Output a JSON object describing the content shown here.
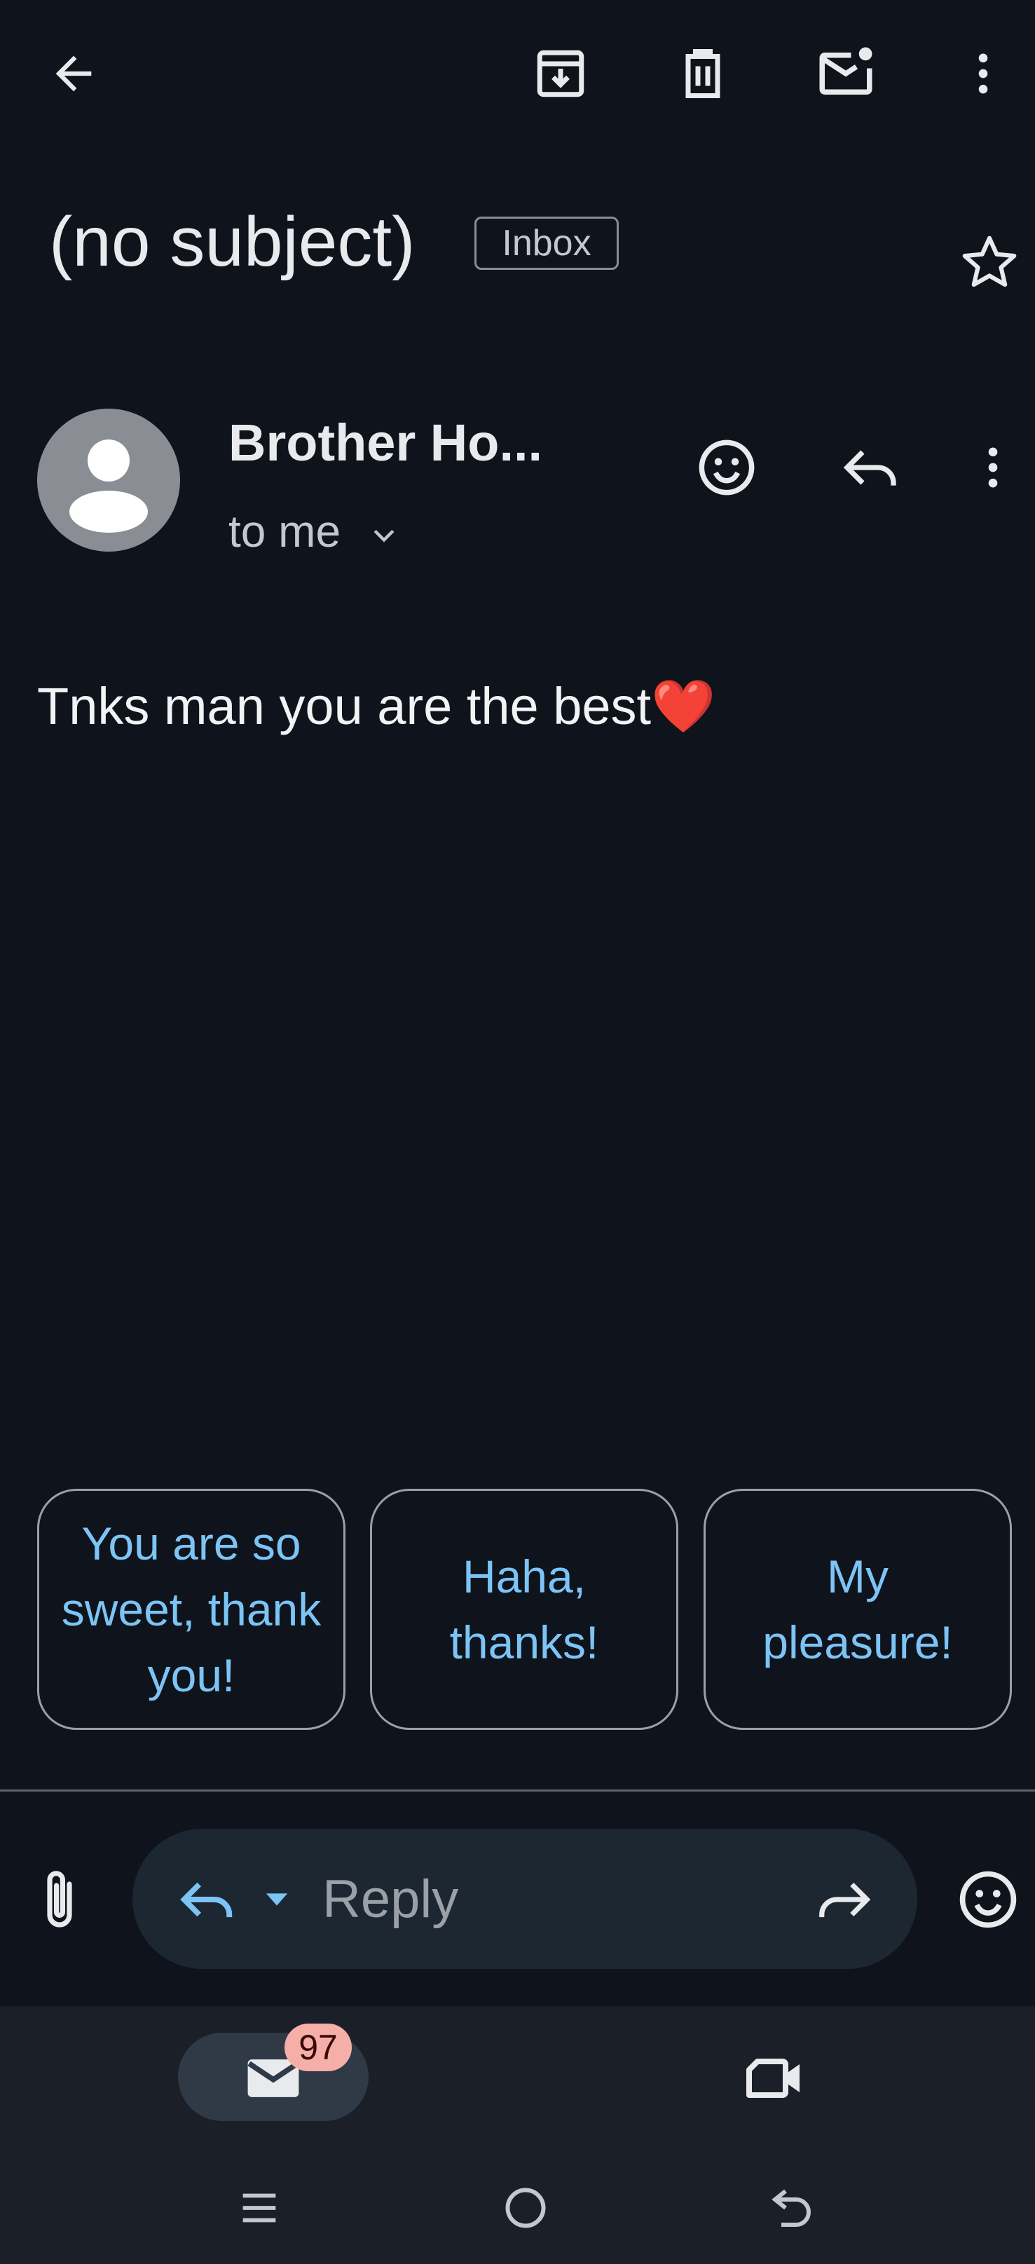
{
  "toolbar": {
    "back_icon": "arrow-back-icon",
    "archive_icon": "archive-icon",
    "delete_icon": "trash-icon",
    "mark_unread_icon": "mark-unread-icon",
    "more_icon": "more-vert-icon"
  },
  "email": {
    "subject": "(no subject)",
    "label": "Inbox",
    "starred": false,
    "sender_name": "Brother Ho...",
    "recipient_summary": "to me",
    "body": "Tnks man you are the best❤️"
  },
  "smart_replies": [
    {
      "label": "You are so sweet, thank you!"
    },
    {
      "label": "Haha, thanks!"
    },
    {
      "label": "My pleasure!"
    }
  ],
  "reply_bar": {
    "placeholder": "Reply",
    "attach_icon": "paperclip-icon",
    "reply_icon": "reply-icon",
    "dropdown_icon": "caret-down-icon",
    "forward_icon": "forward-icon",
    "emoji_icon": "emoji-icon"
  },
  "bottom_nav": {
    "mail_badge": "97",
    "mail_icon": "mail-icon",
    "meet_icon": "video-icon"
  },
  "system_nav": {
    "recents_icon": "recents-icon",
    "home_icon": "home-icon",
    "back_icon": "back-gesture-icon"
  },
  "colors": {
    "background": "#0f131b",
    "accent": "#7cc4f5",
    "badge": "#f6aea9"
  }
}
